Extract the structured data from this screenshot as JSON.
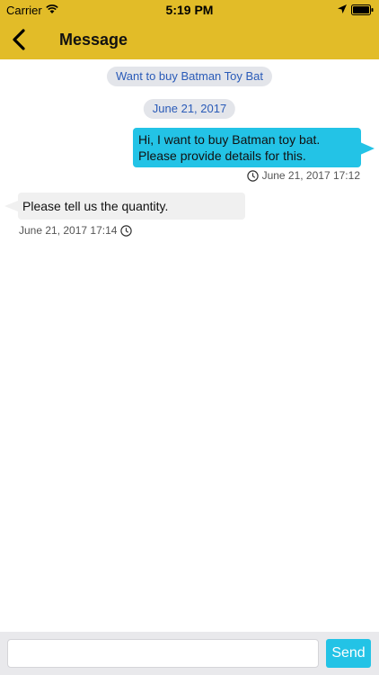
{
  "status_bar": {
    "carrier": "Carrier",
    "time": "5:19 PM",
    "icons": [
      "wifi-icon",
      "location-icon",
      "battery-icon"
    ]
  },
  "nav": {
    "back_icon": "chevron-left-icon",
    "title": "Message"
  },
  "conversation": {
    "subject": "Want to buy Batman Toy Bat",
    "date_separator": "June 21, 2017",
    "messages": [
      {
        "direction": "outgoing",
        "text": "Hi, I want to buy Batman toy bat. Please provide details for this.",
        "timestamp": "June 21, 2017 17:12",
        "icon": "clock-icon"
      },
      {
        "direction": "incoming",
        "text": "Please tell us the quantity.",
        "timestamp": "June 21, 2017 17:14",
        "icon": "clock-icon"
      }
    ]
  },
  "composer": {
    "input_value": "",
    "placeholder": "",
    "send_label": "Send"
  },
  "colors": {
    "header": "#e2bc28",
    "outgoing_bubble": "#23c3e6",
    "incoming_bubble": "#f0f0f0",
    "pill_bg": "#e3e5ea",
    "pill_text": "#2a5bb8",
    "send_button": "#23c3e6"
  }
}
